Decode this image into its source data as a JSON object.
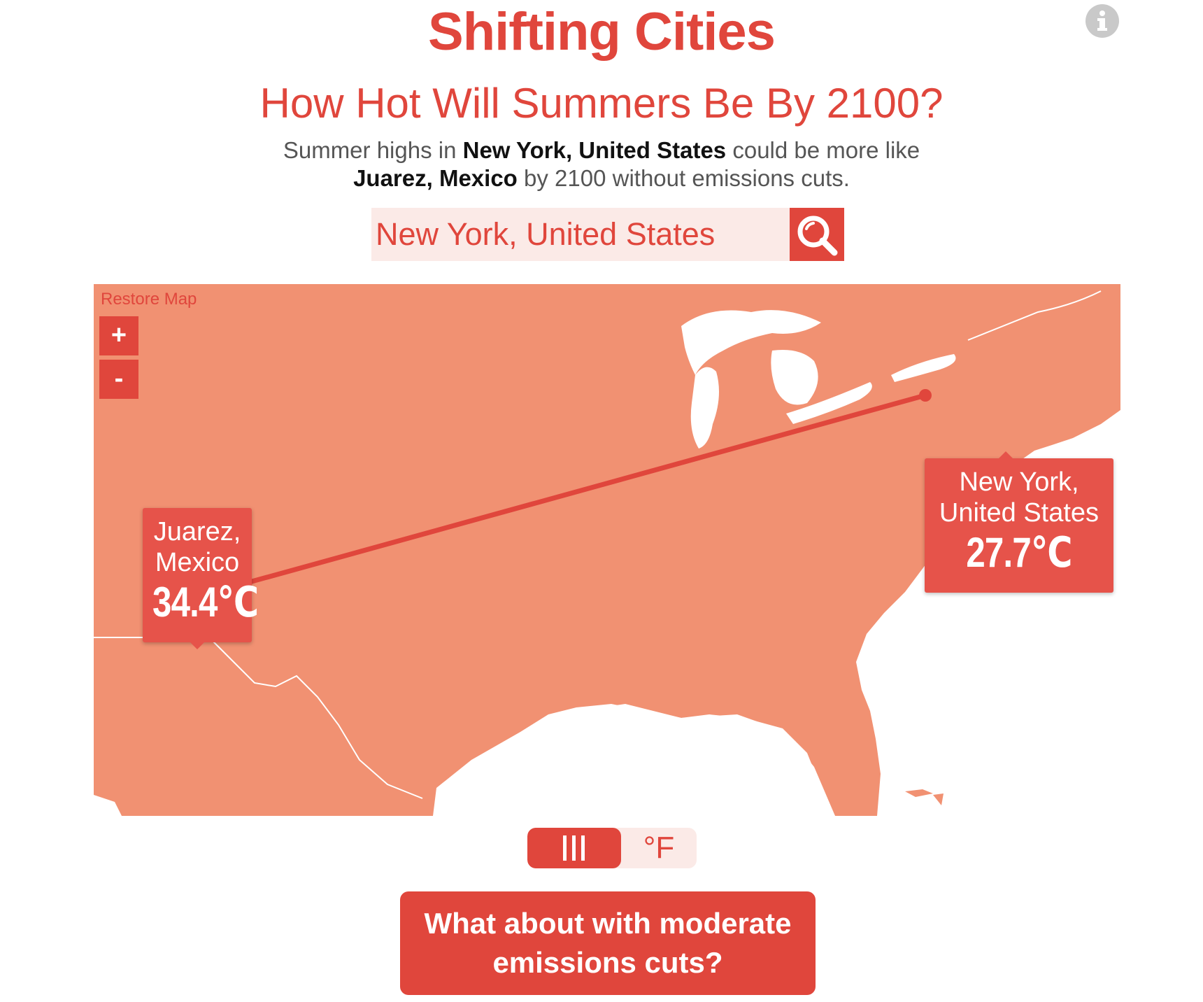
{
  "header": {
    "title": "Shifting Cities",
    "subtitle": "How Hot Will Summers Be By 2100?",
    "summary_prefix": "Summer highs in ",
    "summary_city": "New York, United States",
    "summary_middle": " could be more like",
    "summary_analog": "Juarez, Mexico",
    "summary_suffix": " by 2100 without emissions cuts."
  },
  "info_button": {
    "icon": "info-icon"
  },
  "search": {
    "value": "New York, United States",
    "icon": "search-icon"
  },
  "map": {
    "restore_label": "Restore Map",
    "zoom_in_label": "+",
    "zoom_out_label": "-",
    "land_color": "#f19172",
    "accent_color": "#e0463c",
    "origin": {
      "name_line1": "New York,",
      "name_line2": "United States",
      "temp": "27.7℃"
    },
    "analog": {
      "name_line1": "Juarez,",
      "name_line2": "Mexico",
      "temp": "34.4℃"
    }
  },
  "units": {
    "selected": "celsius",
    "celsius_icon": "menu-bars-icon",
    "fahrenheit_label": "°F"
  },
  "cta": {
    "line1": "What about with moderate",
    "line2": "emissions cuts?"
  }
}
